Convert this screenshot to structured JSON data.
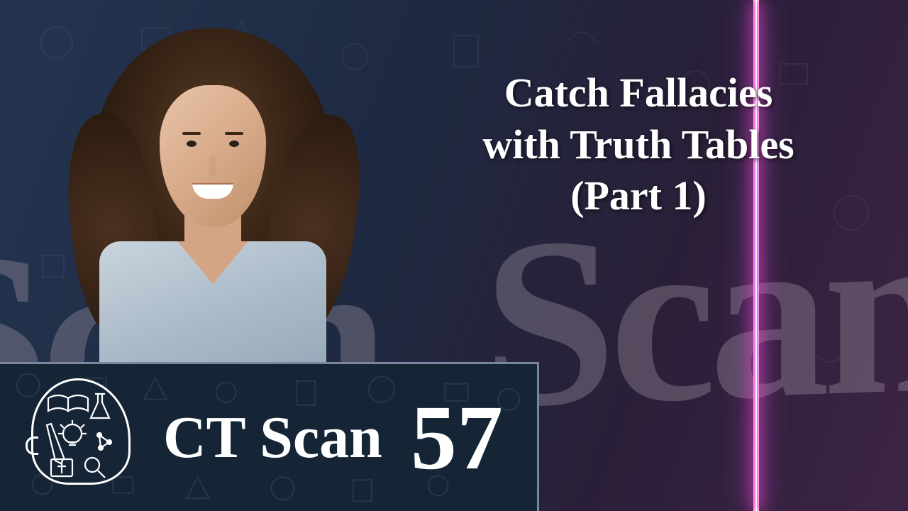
{
  "title": {
    "line1": "Catch Fallacies",
    "line2": "with Truth Tables",
    "line3": "(Part 1)"
  },
  "series": {
    "name": "CT Scan",
    "episode": "57",
    "bg_word": "Scan"
  },
  "logo_alt": "head-silhouette-with-books-lightbulb-and-science-icons"
}
